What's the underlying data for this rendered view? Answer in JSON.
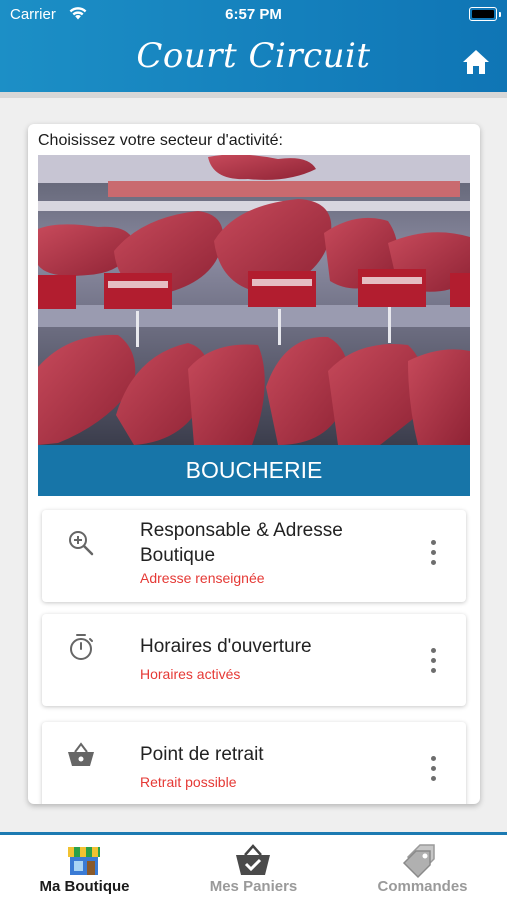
{
  "status_bar": {
    "carrier": "Carrier",
    "time": "6:57 PM"
  },
  "header": {
    "brand": "Court Circuit",
    "home_icon": "home-icon"
  },
  "card": {
    "prompt": "Choisissez votre secteur d'activité:",
    "sector": {
      "label": "BOUCHERIE"
    },
    "items": [
      {
        "title_line1": "Responsable & Adresse",
        "title_line2": "Boutique",
        "status": "Adresse renseignée",
        "icon": "zoom-in-icon"
      },
      {
        "title": "Horaires d'ouverture",
        "status": "Horaires activés",
        "icon": "timer-icon"
      },
      {
        "title": "Point de retrait",
        "status": "Retrait possible",
        "icon": "basket-icon"
      }
    ]
  },
  "tabs": [
    {
      "label": "Ma Boutique",
      "icon": "shop-icon",
      "active": true
    },
    {
      "label": "Mes Paniers",
      "icon": "basket-check-icon",
      "active": false
    },
    {
      "label": "Commandes",
      "icon": "tags-icon",
      "active": false
    }
  ],
  "colors": {
    "header": "#1c8fc6",
    "banner": "#1775a8",
    "status_red": "#e53935",
    "active_tab": "#1b1b1b",
    "inactive_tab": "#9a9a9a"
  }
}
